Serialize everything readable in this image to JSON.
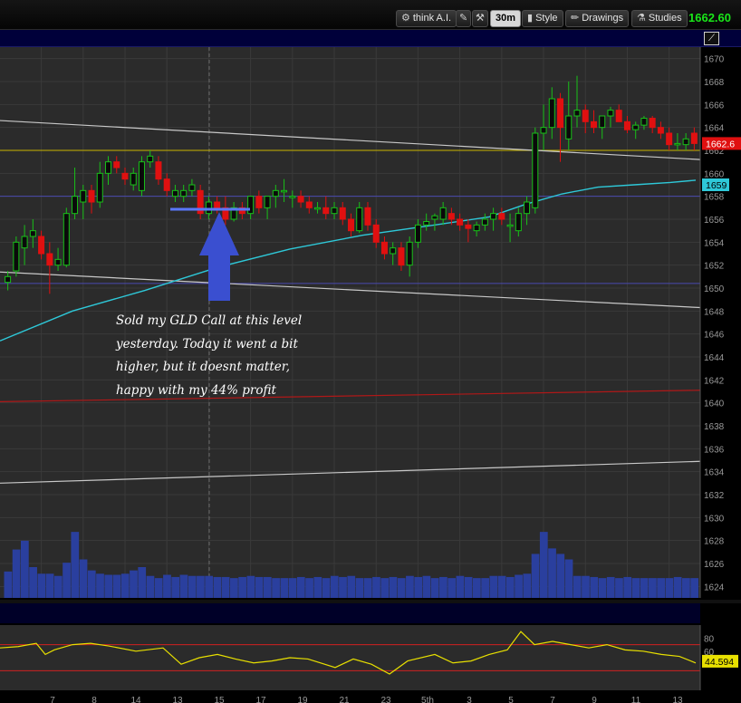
{
  "toolbar": {
    "think_ai": "think A.I.",
    "timeframe": "30m",
    "style": "Style",
    "drawings": "Drawings",
    "studies": "Studies",
    "last_price": "1662.60"
  },
  "annotation": {
    "lines": [
      "Sold my GLD Call at this level",
      "yesterday. Today it went a bit",
      "higher, but it doesnt matter,",
      "happy with my 44% profit"
    ]
  },
  "colors": {
    "up_candle": "#18c018",
    "down_candle": "#e01010",
    "volume": "#2a3f9e",
    "sma": "#2ec8d8",
    "oscillator": "#e8e000",
    "arrow": "#3a4fd0"
  },
  "chart_data": {
    "type": "candlestick",
    "price_axis": {
      "range": [
        1623,
        1671
      ],
      "ticks": [
        1624,
        1626,
        1628,
        1630,
        1632,
        1634,
        1636,
        1638,
        1640,
        1642,
        1644,
        1646,
        1648,
        1650,
        1652,
        1654,
        1656,
        1658,
        1660,
        1662,
        1664,
        1666,
        1668,
        1670
      ]
    },
    "price_labels": {
      "last": "1662.6",
      "sma": "1659"
    },
    "horizontal_lines": [
      {
        "price": 1662.0,
        "color": "#c8b400"
      },
      {
        "price": 1658.0,
        "color": "#4a4ab0"
      },
      {
        "price": 1650.4,
        "color": "#4a4ab0"
      }
    ],
    "trendlines": [
      {
        "from": [
          0,
          1664.6
        ],
        "to": [
          773,
          1661.2
        ],
        "color": "#c8c8c8"
      },
      {
        "from": [
          0,
          1651.4
        ],
        "to": [
          773,
          1648.3
        ],
        "color": "#c8c8c8"
      },
      {
        "from": [
          0,
          1640.1
        ],
        "to": [
          773,
          1641.1
        ],
        "color": "#b01818"
      },
      {
        "from": [
          0,
          1633.0
        ],
        "to": [
          773,
          1634.9
        ],
        "color": "#c8c8c8"
      }
    ],
    "candles": [
      {
        "o": 1650.5,
        "h": 1651.5,
        "l": 1649.8,
        "c": 1651.0
      },
      {
        "o": 1651.5,
        "h": 1654.5,
        "l": 1651.0,
        "c": 1654.0
      },
      {
        "o": 1653.5,
        "h": 1655.5,
        "l": 1652.0,
        "c": 1654.5
      },
      {
        "o": 1654.5,
        "h": 1656.0,
        "l": 1653.5,
        "c": 1655.0
      },
      {
        "o": 1654.5,
        "h": 1655.0,
        "l": 1652.5,
        "c": 1653.0
      },
      {
        "o": 1653.0,
        "h": 1654.0,
        "l": 1649.5,
        "c": 1652.0
      },
      {
        "o": 1652.0,
        "h": 1653.5,
        "l": 1651.5,
        "c": 1652.5
      },
      {
        "o": 1652.0,
        "h": 1657.0,
        "l": 1651.8,
        "c": 1656.5
      },
      {
        "o": 1656.5,
        "h": 1660.5,
        "l": 1656.0,
        "c": 1658.0
      },
      {
        "o": 1657.5,
        "h": 1659.0,
        "l": 1656.0,
        "c": 1658.5
      },
      {
        "o": 1658.5,
        "h": 1659.0,
        "l": 1656.5,
        "c": 1657.5
      },
      {
        "o": 1657.5,
        "h": 1661.0,
        "l": 1657.0,
        "c": 1660.0
      },
      {
        "o": 1660.0,
        "h": 1661.5,
        "l": 1659.0,
        "c": 1661.0
      },
      {
        "o": 1661.0,
        "h": 1661.5,
        "l": 1660.0,
        "c": 1660.5
      },
      {
        "o": 1660.0,
        "h": 1660.5,
        "l": 1659.0,
        "c": 1659.5
      },
      {
        "o": 1659.0,
        "h": 1660.5,
        "l": 1658.5,
        "c": 1660.0
      },
      {
        "o": 1658.5,
        "h": 1661.5,
        "l": 1658.0,
        "c": 1661.0
      },
      {
        "o": 1661.0,
        "h": 1662.0,
        "l": 1660.5,
        "c": 1661.5
      },
      {
        "o": 1661.0,
        "h": 1661.5,
        "l": 1659.0,
        "c": 1659.5
      },
      {
        "o": 1659.5,
        "h": 1660.0,
        "l": 1658.0,
        "c": 1658.5
      },
      {
        "o": 1658.0,
        "h": 1659.0,
        "l": 1657.5,
        "c": 1658.5
      },
      {
        "o": 1658.0,
        "h": 1659.0,
        "l": 1657.5,
        "c": 1658.5
      },
      {
        "o": 1658.5,
        "h": 1659.5,
        "l": 1658.0,
        "c": 1659.0
      },
      {
        "o": 1658.5,
        "h": 1659.0,
        "l": 1656.0,
        "c": 1656.5
      },
      {
        "o": 1656.5,
        "h": 1658.0,
        "l": 1656.0,
        "c": 1657.5
      },
      {
        "o": 1657.5,
        "h": 1658.0,
        "l": 1656.5,
        "c": 1657.0
      },
      {
        "o": 1657.0,
        "h": 1658.0,
        "l": 1655.5,
        "c": 1656.0
      },
      {
        "o": 1656.0,
        "h": 1657.5,
        "l": 1655.8,
        "c": 1657.0
      },
      {
        "o": 1657.0,
        "h": 1657.5,
        "l": 1656.0,
        "c": 1656.5
      },
      {
        "o": 1656.5,
        "h": 1658.0,
        "l": 1656.0,
        "c": 1658.0
      },
      {
        "o": 1658.0,
        "h": 1658.5,
        "l": 1656.5,
        "c": 1657.0
      },
      {
        "o": 1657.0,
        "h": 1658.0,
        "l": 1656.0,
        "c": 1658.0
      },
      {
        "o": 1658.0,
        "h": 1659.0,
        "l": 1657.0,
        "c": 1658.5
      },
      {
        "o": 1658.5,
        "h": 1659.5,
        "l": 1657.5,
        "c": 1658.5
      },
      {
        "o": 1658.0,
        "h": 1658.5,
        "l": 1657.0,
        "c": 1658.0
      },
      {
        "o": 1658.0,
        "h": 1658.5,
        "l": 1657.0,
        "c": 1657.5
      },
      {
        "o": 1657.5,
        "h": 1658.0,
        "l": 1656.5,
        "c": 1657.0
      },
      {
        "o": 1657.0,
        "h": 1657.5,
        "l": 1656.5,
        "c": 1657.0
      },
      {
        "o": 1657.0,
        "h": 1658.0,
        "l": 1656.0,
        "c": 1656.5
      },
      {
        "o": 1656.5,
        "h": 1657.5,
        "l": 1656.0,
        "c": 1657.0
      },
      {
        "o": 1657.0,
        "h": 1657.5,
        "l": 1655.5,
        "c": 1656.0
      },
      {
        "o": 1656.0,
        "h": 1656.5,
        "l": 1654.5,
        "c": 1655.0
      },
      {
        "o": 1655.0,
        "h": 1657.5,
        "l": 1654.8,
        "c": 1657.0
      },
      {
        "o": 1657.0,
        "h": 1657.5,
        "l": 1655.0,
        "c": 1655.5
      },
      {
        "o": 1655.5,
        "h": 1656.0,
        "l": 1653.5,
        "c": 1654.0
      },
      {
        "o": 1654.0,
        "h": 1654.5,
        "l": 1652.5,
        "c": 1653.0
      },
      {
        "o": 1653.0,
        "h": 1654.0,
        "l": 1652.0,
        "c": 1653.5
      },
      {
        "o": 1653.5,
        "h": 1654.0,
        "l": 1651.5,
        "c": 1652.0
      },
      {
        "o": 1652.0,
        "h": 1654.5,
        "l": 1651.0,
        "c": 1654.0
      },
      {
        "o": 1654.0,
        "h": 1656.0,
        "l": 1653.5,
        "c": 1655.5
      },
      {
        "o": 1655.5,
        "h": 1656.5,
        "l": 1655.0,
        "c": 1655.8
      },
      {
        "o": 1656.0,
        "h": 1656.5,
        "l": 1655.0,
        "c": 1656.3
      },
      {
        "o": 1656.0,
        "h": 1657.5,
        "l": 1655.5,
        "c": 1657.0
      },
      {
        "o": 1656.5,
        "h": 1657.0,
        "l": 1655.5,
        "c": 1656.0
      },
      {
        "o": 1656.0,
        "h": 1656.5,
        "l": 1655.0,
        "c": 1655.5
      },
      {
        "o": 1655.5,
        "h": 1656.0,
        "l": 1654.0,
        "c": 1655.2
      },
      {
        "o": 1655.0,
        "h": 1655.8,
        "l": 1654.5,
        "c": 1655.5
      },
      {
        "o": 1655.5,
        "h": 1656.5,
        "l": 1655.0,
        "c": 1656.0
      },
      {
        "o": 1656.0,
        "h": 1657.0,
        "l": 1655.0,
        "c": 1656.5
      },
      {
        "o": 1656.5,
        "h": 1657.0,
        "l": 1655.5,
        "c": 1656.0
      },
      {
        "o": 1655.5,
        "h": 1656.5,
        "l": 1654.0,
        "c": 1655.5
      },
      {
        "o": 1655.0,
        "h": 1657.0,
        "l": 1654.5,
        "c": 1656.5
      },
      {
        "o": 1656.5,
        "h": 1658.0,
        "l": 1655.5,
        "c": 1657.5
      },
      {
        "o": 1657.0,
        "h": 1664.0,
        "l": 1656.5,
        "c": 1663.5
      },
      {
        "o": 1663.5,
        "h": 1666.0,
        "l": 1662.0,
        "c": 1664.0
      },
      {
        "o": 1664.0,
        "h": 1667.5,
        "l": 1663.0,
        "c": 1666.5
      },
      {
        "o": 1666.5,
        "h": 1667.0,
        "l": 1661.0,
        "c": 1664.0
      },
      {
        "o": 1663.0,
        "h": 1668.0,
        "l": 1662.0,
        "c": 1665.0
      },
      {
        "o": 1665.0,
        "h": 1668.5,
        "l": 1664.0,
        "c": 1665.5
      },
      {
        "o": 1665.5,
        "h": 1666.0,
        "l": 1663.5,
        "c": 1664.5
      },
      {
        "o": 1664.5,
        "h": 1665.5,
        "l": 1663.5,
        "c": 1664.0
      },
      {
        "o": 1664.0,
        "h": 1665.0,
        "l": 1663.0,
        "c": 1665.0
      },
      {
        "o": 1665.0,
        "h": 1665.8,
        "l": 1664.0,
        "c": 1665.5
      },
      {
        "o": 1665.5,
        "h": 1666.0,
        "l": 1664.5,
        "c": 1664.5
      },
      {
        "o": 1664.5,
        "h": 1665.0,
        "l": 1663.5,
        "c": 1663.8
      },
      {
        "o": 1663.8,
        "h": 1664.5,
        "l": 1663.0,
        "c": 1664.2
      },
      {
        "o": 1664.2,
        "h": 1665.0,
        "l": 1663.8,
        "c": 1664.8
      },
      {
        "o": 1664.8,
        "h": 1665.0,
        "l": 1663.5,
        "c": 1664.0
      },
      {
        "o": 1664.0,
        "h": 1664.5,
        "l": 1663.0,
        "c": 1663.5
      },
      {
        "o": 1663.5,
        "h": 1664.0,
        "l": 1662.0,
        "c": 1662.5
      },
      {
        "o": 1662.5,
        "h": 1663.5,
        "l": 1662.0,
        "c": 1662.6
      },
      {
        "o": 1662.5,
        "h": 1663.5,
        "l": 1662.0,
        "c": 1663.0
      },
      {
        "o": 1663.5,
        "h": 1664.0,
        "l": 1662.0,
        "c": 1662.6
      }
    ],
    "volume": [
      24,
      44,
      52,
      28,
      22,
      22,
      20,
      32,
      60,
      35,
      25,
      22,
      21,
      21,
      22,
      25,
      28,
      20,
      18,
      21,
      19,
      21,
      20,
      20,
      20,
      19,
      19,
      18,
      19,
      20,
      19,
      19,
      18,
      18,
      18,
      19,
      18,
      19,
      18,
      20,
      19,
      20,
      18,
      18,
      19,
      18,
      19,
      18,
      20,
      19,
      20,
      18,
      19,
      18,
      20,
      19,
      18,
      18,
      20,
      20,
      19,
      21,
      22,
      40,
      60,
      45,
      40,
      35,
      20,
      20,
      19,
      18,
      19,
      18,
      19,
      18,
      18,
      18,
      18,
      18,
      19,
      18,
      18
    ],
    "sma": [
      [
        0,
        1645.4
      ],
      [
        80,
        1648.0
      ],
      [
        160,
        1649.8
      ],
      [
        240,
        1651.8
      ],
      [
        320,
        1653.4
      ],
      [
        400,
        1654.6
      ],
      [
        480,
        1655.5
      ],
      [
        540,
        1656.2
      ],
      [
        580,
        1657.3
      ],
      [
        620,
        1658.2
      ],
      [
        660,
        1658.8
      ],
      [
        700,
        1659.0
      ],
      [
        740,
        1659.2
      ],
      [
        768,
        1659.4
      ]
    ],
    "oscillator": {
      "range": [
        0,
        100
      ],
      "levels": [
        80,
        60
      ],
      "upper_line": 70,
      "lower_line": 30,
      "last_value": "44.594",
      "points": [
        [
          0,
          65
        ],
        [
          20,
          67
        ],
        [
          40,
          72
        ],
        [
          50,
          55
        ],
        [
          60,
          62
        ],
        [
          80,
          70
        ],
        [
          100,
          72
        ],
        [
          120,
          68
        ],
        [
          150,
          60
        ],
        [
          180,
          65
        ],
        [
          200,
          40
        ],
        [
          220,
          50
        ],
        [
          240,
          55
        ],
        [
          260,
          48
        ],
        [
          280,
          42
        ],
        [
          300,
          45
        ],
        [
          320,
          50
        ],
        [
          340,
          48
        ],
        [
          370,
          35
        ],
        [
          390,
          48
        ],
        [
          410,
          40
        ],
        [
          430,
          25
        ],
        [
          450,
          45
        ],
        [
          480,
          55
        ],
        [
          500,
          42
        ],
        [
          520,
          45
        ],
        [
          540,
          55
        ],
        [
          560,
          62
        ],
        [
          575,
          90
        ],
        [
          590,
          70
        ],
        [
          610,
          75
        ],
        [
          630,
          70
        ],
        [
          650,
          65
        ],
        [
          670,
          70
        ],
        [
          690,
          62
        ],
        [
          710,
          60
        ],
        [
          730,
          55
        ],
        [
          750,
          52
        ],
        [
          768,
          42
        ]
      ]
    },
    "x_axis": {
      "tick_labels": [
        "7",
        "8",
        "14",
        "13",
        "15",
        "17",
        "19",
        "21",
        "23",
        "5th",
        "3",
        "5",
        "7",
        "9",
        "11",
        "13"
      ]
    }
  }
}
